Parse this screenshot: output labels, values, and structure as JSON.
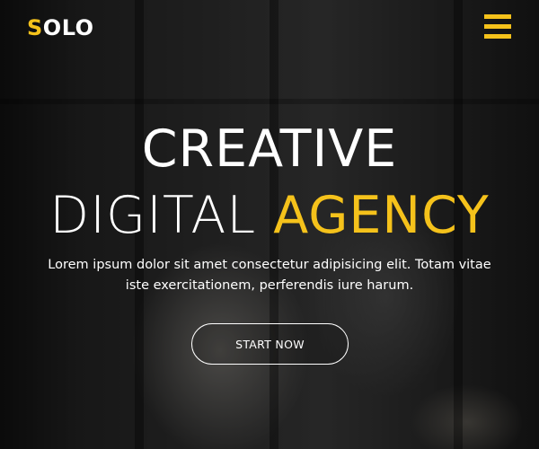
{
  "header": {
    "logo_accent": "S",
    "logo_rest": "OLO",
    "menu_icon": "hamburger-menu-icon"
  },
  "hero": {
    "title_line1": "CREATIVE",
    "title_line2_part1": "DIGITAL ",
    "title_line2_highlight": "AGENCY",
    "subtitle_line1": "Lorem ipsum dolor sit amet consectetur adipisicing elit. Totam vitae",
    "subtitle_line2": "iste exercitationem, perferendis iure harum.",
    "cta_label": "START NOW"
  },
  "colors": {
    "accent": "#f5c21b",
    "text": "#ffffff"
  }
}
